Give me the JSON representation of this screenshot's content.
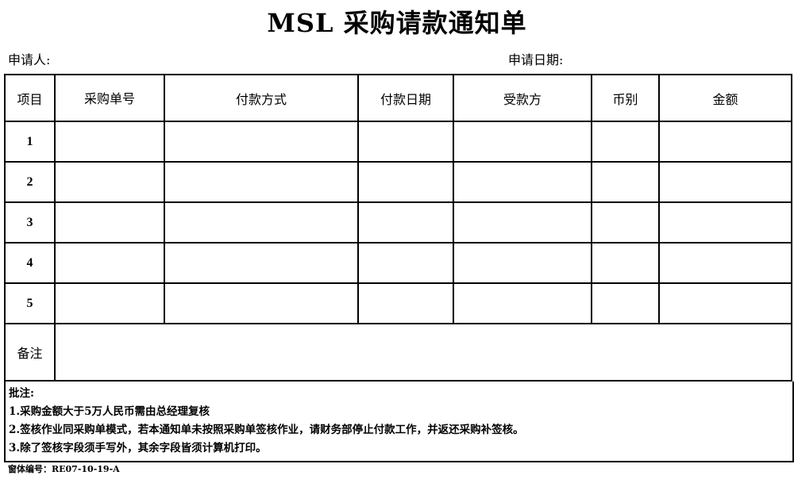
{
  "title": "MSL 采购请款通知单",
  "applicant_label": "申请人:",
  "apply_date_label": "申请日期:",
  "table": {
    "headers": [
      "项目",
      "采购单号",
      "付款方式",
      "付款日期",
      "受款方",
      "币别",
      "金额"
    ],
    "rows": [
      "1",
      "2",
      "3",
      "4",
      "5"
    ],
    "remark_label": "备注"
  },
  "notes": {
    "heading": "批注:",
    "items": [
      "1.采购金额大于5万人民币需由总经理复核",
      "2.签核作业同采购单模式，若本通知单未按照采购单签核作业，请财务部停止付款工作，并返还采购补签核。",
      "3.除了签核字段须手写外，其余字段皆须计算机打印。"
    ]
  },
  "form_number": "窗体编号：RE07-10-19-A"
}
